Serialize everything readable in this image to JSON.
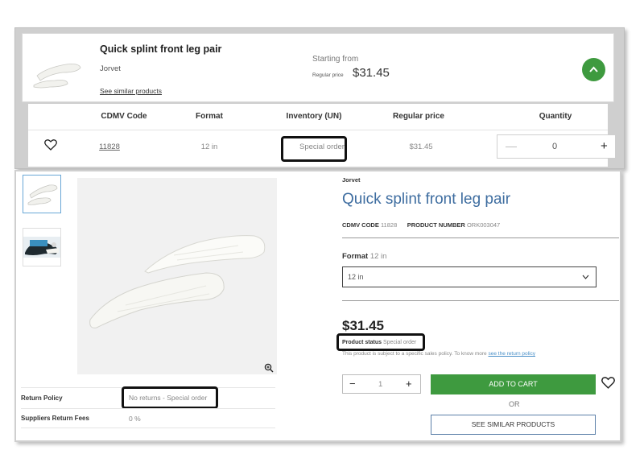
{
  "top": {
    "product_title": "Quick splint front leg pair",
    "brand": "Jorvet",
    "see_similar": "See similar products",
    "starting_from": "Starting from",
    "regular_price_label": "Regular price",
    "price": "$31.45",
    "chevron_icon": "chevron-up-icon",
    "accent": "#3e9a3f"
  },
  "table": {
    "headers": [
      "CDMV Code",
      "Format",
      "Inventory (UN)",
      "Regular price",
      "Quantity"
    ],
    "row": {
      "favorite_icon": "heart-icon",
      "code": "11828",
      "format": "12 in",
      "inventory": "Special order",
      "price": "$31.45",
      "quantity": "0"
    }
  },
  "detail": {
    "brand": "Jorvet",
    "title": "Quick splint front leg pair",
    "cdmv_code_label": "CDMV CODE",
    "cdmv_code": "11828",
    "product_number_label": "PRODUCT NUMBER",
    "product_number": "ORK003047",
    "format_label": "Format",
    "format_value": "12 in",
    "format_select": "12 in",
    "price": "$31.45",
    "status_label": "Product status",
    "status_value": "Special order",
    "policy_note": "This product is subject to a specific sales policy. To know more",
    "policy_link": "see the return policy",
    "qty_value": "1",
    "add_to_cart": "ADD TO CART",
    "or": "OR",
    "see_similar_button": "SEE SIMILAR PRODUCTS",
    "return_policy_label": "Return Policy",
    "return_policy_value": "No returns - Special order",
    "supplier_fees_label": "Suppliers Return Fees",
    "supplier_fees_value": "0 %"
  }
}
